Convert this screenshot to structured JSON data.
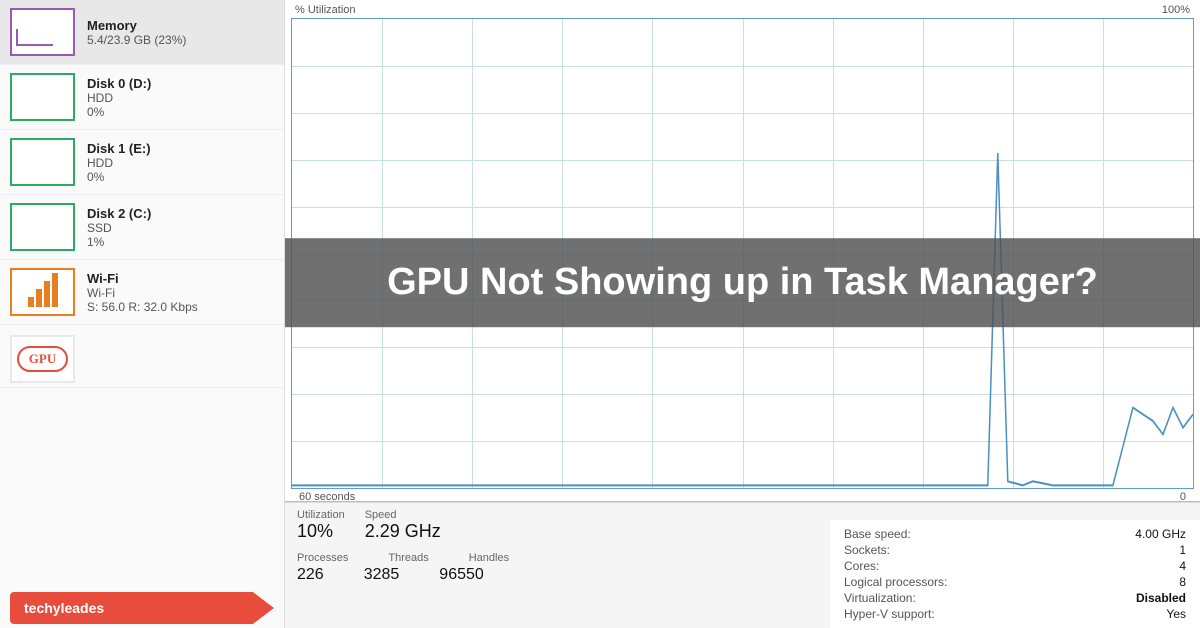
{
  "sidebar": {
    "items": [
      {
        "id": "memory",
        "name": "Memory",
        "sub": "5.4/23.9 GB (23%)",
        "val": "",
        "color": "#9b59b6"
      },
      {
        "id": "disk0",
        "name": "Disk 0 (D:)",
        "sub": "HDD",
        "val": "0%",
        "color": "#27ae60"
      },
      {
        "id": "disk1",
        "name": "Disk 1 (E:)",
        "sub": "HDD",
        "val": "0%",
        "color": "#27ae60"
      },
      {
        "id": "disk2",
        "name": "Disk 2 (C:)",
        "sub": "SSD",
        "val": "1%",
        "color": "#27ae60"
      },
      {
        "id": "wifi",
        "name": "Wi-Fi",
        "sub": "Wi-Fi",
        "val": "S: 56.0  R: 32.0 Kbps",
        "color": "#e67e22"
      }
    ],
    "gpu_label": "GPU",
    "brand_label": "techyleades"
  },
  "chart": {
    "y_label": "% Utilization",
    "y_max": "100%",
    "x_label": "60 seconds",
    "x_end": "0"
  },
  "stats": {
    "utilization_label": "Utilization",
    "utilization_value": "10%",
    "speed_label": "Speed",
    "speed_value": "2.29 GHz",
    "processes_label": "Processes",
    "processes_value": "226",
    "threads_label": "Threads",
    "threads_value": "3285",
    "handles_label": "Handles",
    "handles_value": "96550"
  },
  "info": {
    "base_speed_label": "Base speed:",
    "base_speed_value": "4.00 GHz",
    "sockets_label": "Sockets:",
    "sockets_value": "1",
    "cores_label": "Cores:",
    "cores_value": "4",
    "logical_label": "Logical processors:",
    "logical_value": "8",
    "virt_label": "Virtualization:",
    "virt_value": "Disabled",
    "hyperv_label": "Hyper-V support:",
    "hyperv_value": "Yes"
  },
  "overlay": {
    "title": "GPU Not Showing up in Task Manager?"
  }
}
